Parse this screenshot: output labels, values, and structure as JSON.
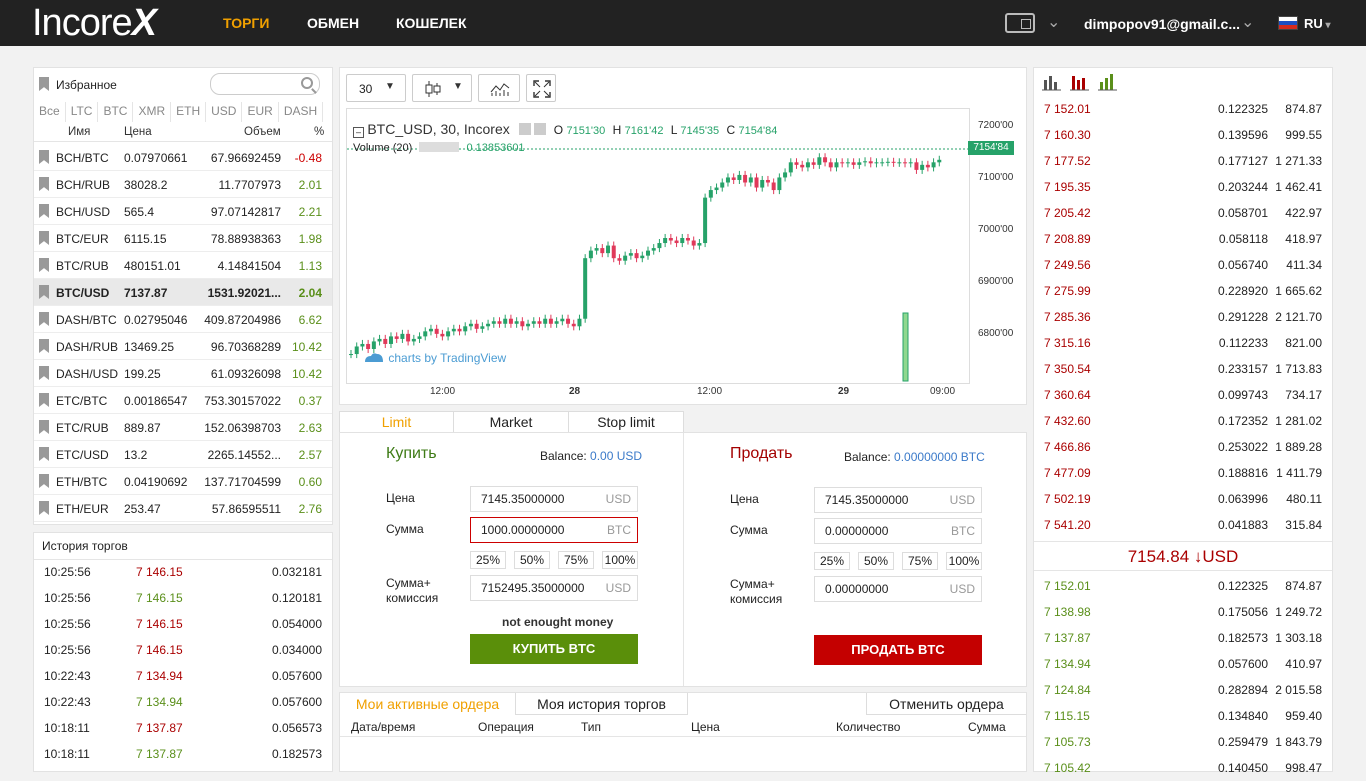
{
  "header": {
    "logo": "Incore",
    "logo_x": "X",
    "nav": [
      "ТОРГИ",
      "ОБМЕН",
      "КОШЕЛЕК"
    ],
    "user_email": "dimpopov91@gmail.c...",
    "lang": "RU"
  },
  "favorites": {
    "title": "Избранное",
    "tabs": [
      "Все",
      "LTC",
      "BTC",
      "XMR",
      "ETH",
      "USD",
      "EUR",
      "DASH"
    ],
    "columns": [
      "Имя",
      "Цена",
      "Объем",
      "%"
    ],
    "rows": [
      {
        "pair": "BCH/BTC",
        "price": "0.07970661",
        "volume": "67.96692459",
        "pct": "-0.48",
        "dir": "neg"
      },
      {
        "pair": "BCH/RUB",
        "price": "38028.2",
        "volume": "11.7707973",
        "pct": "2.01",
        "dir": "pos"
      },
      {
        "pair": "BCH/USD",
        "price": "565.4",
        "volume": "97.07142817",
        "pct": "2.21",
        "dir": "pos"
      },
      {
        "pair": "BTC/EUR",
        "price": "6115.15",
        "volume": "78.88938363",
        "pct": "1.98",
        "dir": "pos"
      },
      {
        "pair": "BTC/RUB",
        "price": "480151.01",
        "volume": "4.14841504",
        "pct": "1.13",
        "dir": "pos"
      },
      {
        "pair": "BTC/USD",
        "price": "7137.87",
        "volume": "1531.92021...",
        "pct": "2.04",
        "dir": "pos",
        "selected": true
      },
      {
        "pair": "DASH/BTC",
        "price": "0.02795046",
        "volume": "409.87204986",
        "pct": "6.62",
        "dir": "pos"
      },
      {
        "pair": "DASH/RUB",
        "price": "13469.25",
        "volume": "96.70368289",
        "pct": "10.42",
        "dir": "pos"
      },
      {
        "pair": "DASH/USD",
        "price": "199.25",
        "volume": "61.09326098",
        "pct": "10.42",
        "dir": "pos"
      },
      {
        "pair": "ETC/BTC",
        "price": "0.00186547",
        "volume": "753.30157022",
        "pct": "0.37",
        "dir": "pos"
      },
      {
        "pair": "ETC/RUB",
        "price": "889.87",
        "volume": "152.06398703",
        "pct": "2.63",
        "dir": "pos"
      },
      {
        "pair": "ETC/USD",
        "price": "13.2",
        "volume": "2265.14552...",
        "pct": "2.57",
        "dir": "pos"
      },
      {
        "pair": "ETH/BTC",
        "price": "0.04190692",
        "volume": "137.71704599",
        "pct": "0.60",
        "dir": "pos"
      },
      {
        "pair": "ETH/EUR",
        "price": "253.47",
        "volume": "57.86595511",
        "pct": "2.76",
        "dir": "pos"
      }
    ]
  },
  "history": {
    "title": "История торгов",
    "rows": [
      {
        "time": "10:25:56",
        "price": "7 146.15",
        "amount": "0.032181",
        "side": "sell"
      },
      {
        "time": "10:25:56",
        "price": "7 146.15",
        "amount": "0.120181",
        "side": "buy"
      },
      {
        "time": "10:25:56",
        "price": "7 146.15",
        "amount": "0.054000",
        "side": "sell"
      },
      {
        "time": "10:25:56",
        "price": "7 146.15",
        "amount": "0.034000",
        "side": "sell"
      },
      {
        "time": "10:22:43",
        "price": "7 134.94",
        "amount": "0.057600",
        "side": "sell"
      },
      {
        "time": "10:22:43",
        "price": "7 134.94",
        "amount": "0.057600",
        "side": "buy"
      },
      {
        "time": "10:18:11",
        "price": "7 137.87",
        "amount": "0.056573",
        "side": "sell"
      },
      {
        "time": "10:18:11",
        "price": "7 137.87",
        "amount": "0.182573",
        "side": "buy"
      }
    ]
  },
  "chart": {
    "interval": "30",
    "symbol": "BTC_USD, 30, Incorex",
    "ohlc": {
      "o_label": "O",
      "o": "7151'30",
      "h_label": "H",
      "h": "7161'42",
      "l_label": "L",
      "l": "7145'35",
      "c_label": "C",
      "c": "7154'84"
    },
    "volume_label": "Volume (20)",
    "volume_value": "0.13853601",
    "last_price": "7154'84",
    "y_ticks": [
      "7200'00",
      "7100'00",
      "7000'00",
      "6900'00",
      "6800'00"
    ],
    "x_ticks": [
      "12:00",
      "28",
      "12:00",
      "29",
      "09:00"
    ],
    "watermark": "charts by TradingView",
    "up_color": "#26a269",
    "down_color": "#e0395a"
  },
  "order_form": {
    "tabs": [
      "Limit",
      "Market",
      "Stop limit"
    ],
    "buy": {
      "title": "Купить",
      "balance_label": "Balance:",
      "balance": "0.00 USD",
      "price_label": "Цена",
      "price": "7145.35000000",
      "price_unit": "USD",
      "amount_label": "Сумма",
      "amount": "1000.00000000",
      "amount_unit": "BTC",
      "pcts": [
        "25%",
        "50%",
        "75%",
        "100%"
      ],
      "total_label1": "Сумма+",
      "total_label2": "комиссия",
      "total": "7152495.35000000",
      "total_unit": "USD",
      "error": "not enought money",
      "button": "КУПИТЬ BTC"
    },
    "sell": {
      "title": "Продать",
      "balance_label": "Balance:",
      "balance": "0.00000000 BTC",
      "price_label": "Цена",
      "price": "7145.35000000",
      "price_unit": "USD",
      "amount_label": "Сумма",
      "amount": "0.00000000",
      "amount_unit": "BTC",
      "pcts": [
        "25%",
        "50%",
        "75%",
        "100%"
      ],
      "total_label1": "Сумма+",
      "total_label2": "комиссия",
      "total": "0.00000000",
      "total_unit": "USD",
      "button": "ПРОДАТЬ BTC"
    }
  },
  "orders": {
    "tabs": [
      "Мои активные ордера",
      "Моя история торгов"
    ],
    "cancel": "Отменить ордера",
    "columns": [
      "Дата/время",
      "Операция",
      "Тип",
      "Цена",
      "Количество",
      "Сумма"
    ]
  },
  "orderbook": {
    "asks": [
      [
        "7 152.01",
        "0.122325",
        "874.87"
      ],
      [
        "7 160.30",
        "0.139596",
        "999.55"
      ],
      [
        "7 177.52",
        "0.177127",
        "1 271.33"
      ],
      [
        "7 195.35",
        "0.203244",
        "1 462.41"
      ],
      [
        "7 205.42",
        "0.058701",
        "422.97"
      ],
      [
        "7 208.89",
        "0.058118",
        "418.97"
      ],
      [
        "7 249.56",
        "0.056740",
        "411.34"
      ],
      [
        "7 275.99",
        "0.228920",
        "1 665.62"
      ],
      [
        "7 285.36",
        "0.291228",
        "2 121.70"
      ],
      [
        "7 315.16",
        "0.112233",
        "821.00"
      ],
      [
        "7 350.54",
        "0.233157",
        "1 713.83"
      ],
      [
        "7 360.64",
        "0.099743",
        "734.17"
      ],
      [
        "7 432.60",
        "0.172352",
        "1 281.02"
      ],
      [
        "7 466.86",
        "0.253022",
        "1 889.28"
      ],
      [
        "7 477.09",
        "0.188816",
        "1 411.79"
      ],
      [
        "7 502.19",
        "0.063996",
        "480.11"
      ],
      [
        "7 541.20",
        "0.041883",
        "315.84"
      ]
    ],
    "mid_price": "7154.84",
    "mid_arrow": "↓",
    "mid_unit": "USD",
    "bids": [
      [
        "7 152.01",
        "0.122325",
        "874.87"
      ],
      [
        "7 138.98",
        "0.175056",
        "1 249.72"
      ],
      [
        "7 137.87",
        "0.182573",
        "1 303.18"
      ],
      [
        "7 134.94",
        "0.057600",
        "410.97"
      ],
      [
        "7 124.84",
        "0.282894",
        "2 015.58"
      ],
      [
        "7 115.15",
        "0.134840",
        "959.40"
      ],
      [
        "7 105.73",
        "0.259479",
        "1 843.79"
      ],
      [
        "7 105.42",
        "0.140450",
        "998.47"
      ]
    ]
  }
}
